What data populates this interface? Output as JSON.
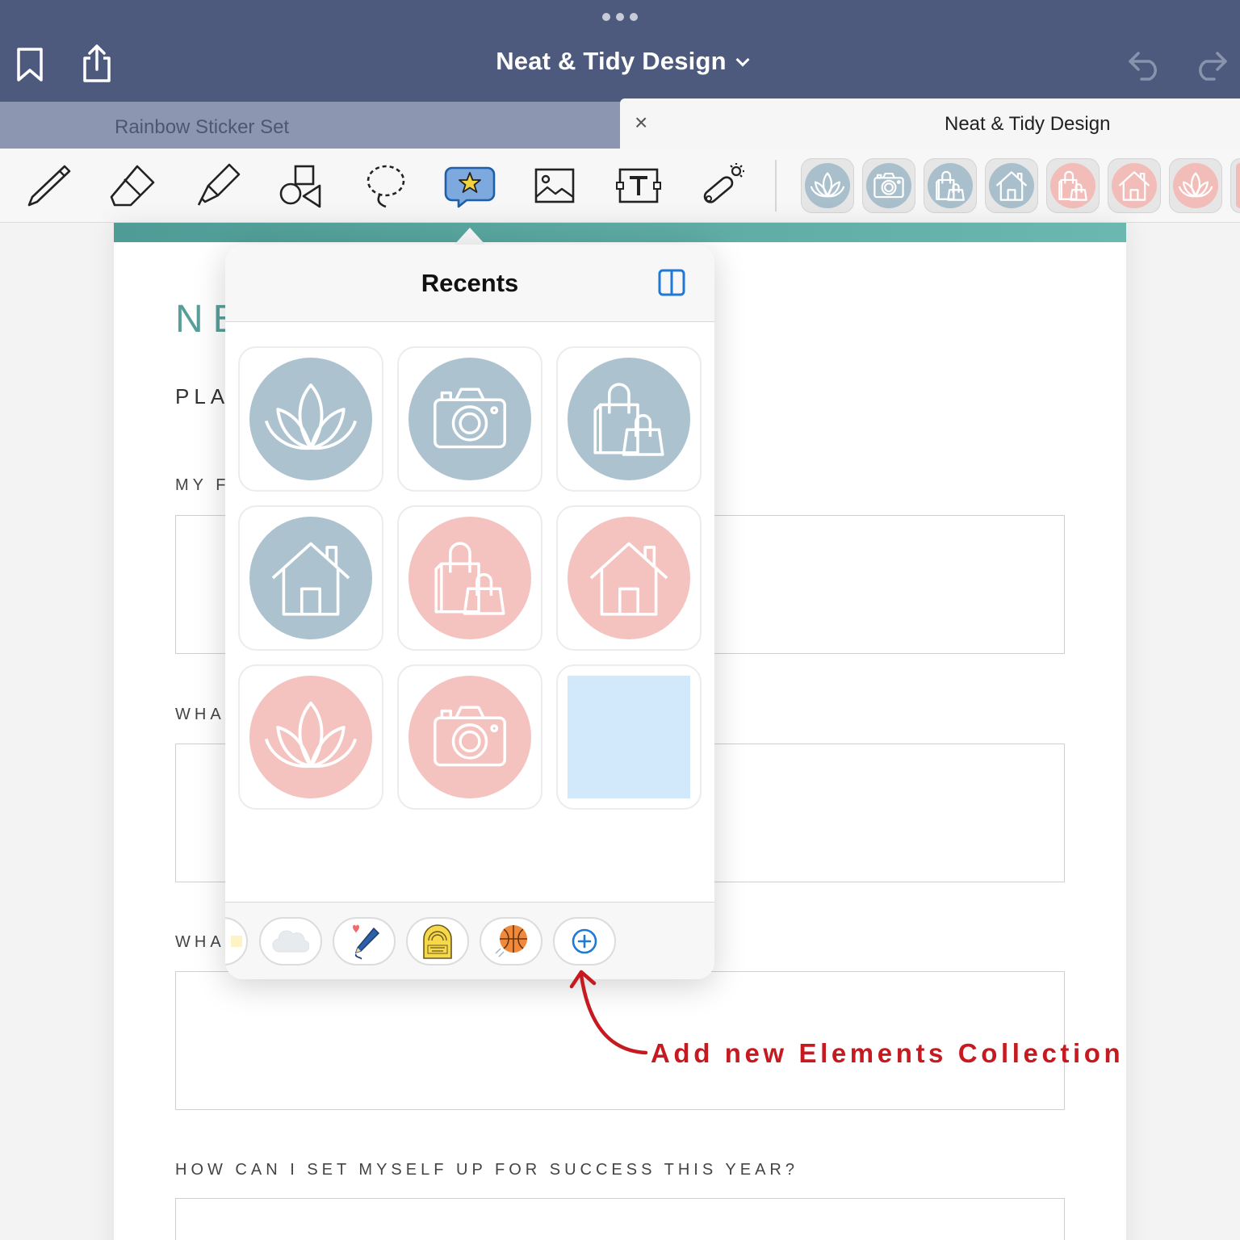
{
  "navbar": {
    "title": "Neat & Tidy Design",
    "left_icons": [
      "bookmark-icon",
      "share-icon"
    ],
    "right_icons": [
      "undo-icon",
      "redo-icon"
    ]
  },
  "tabs": [
    {
      "label": "Rainbow Sticker Set",
      "active": false
    },
    {
      "label": "Neat & Tidy Design",
      "active": true,
      "close": "×"
    }
  ],
  "toolbar": {
    "tools": [
      "pen-icon",
      "eraser-icon",
      "highlighter-icon",
      "shapes-icon",
      "lasso-icon",
      "elements-icon",
      "image-icon",
      "text-icon",
      "laser-pointer-icon"
    ],
    "favorites": [
      {
        "icon": "lotus-icon",
        "color": "#a9bfcc"
      },
      {
        "icon": "camera-icon",
        "color": "#a9bfcc"
      },
      {
        "icon": "shopping-bags-icon",
        "color": "#a9bfcc"
      },
      {
        "icon": "house-icon",
        "color": "#a9bfcc"
      },
      {
        "icon": "shopping-bags-icon",
        "color": "#f2bcb8"
      },
      {
        "icon": "house-icon",
        "color": "#f2bcb8"
      },
      {
        "icon": "lotus-icon",
        "color": "#f2bcb8"
      }
    ]
  },
  "page": {
    "title": "NE",
    "subtitle": "PLA",
    "sections": [
      "MY F",
      "WHA",
      "WHA",
      "HOW CAN I SET MYSELF UP FOR SUCCESS THIS YEAR?"
    ]
  },
  "popover": {
    "title": "Recents",
    "stickers": [
      {
        "icon": "lotus-icon",
        "color": "#adc2cf"
      },
      {
        "icon": "camera-icon",
        "color": "#adc2cf"
      },
      {
        "icon": "shopping-bags-icon",
        "color": "#adc2cf"
      },
      {
        "icon": "house-icon",
        "color": "#adc2cf"
      },
      {
        "icon": "shopping-bags-icon",
        "color": "#f4c3bf"
      },
      {
        "icon": "house-icon",
        "color": "#f4c3bf"
      },
      {
        "icon": "lotus-icon",
        "color": "#f4c3bf"
      },
      {
        "icon": "camera-icon",
        "color": "#f4c3bf"
      },
      {
        "icon": "blank-square",
        "color": "#d2e9fb"
      }
    ],
    "collections": [
      "cloud-icon",
      "pen-heart-icon",
      "thanks-badge-icon",
      "basketball-icon",
      "add-collection-icon"
    ]
  },
  "annotation": {
    "text": "Add new Elements Collection"
  },
  "colors": {
    "navbar": "#4d5a7d",
    "accent": "#1f7ad6",
    "annotation": "#c61a20"
  }
}
